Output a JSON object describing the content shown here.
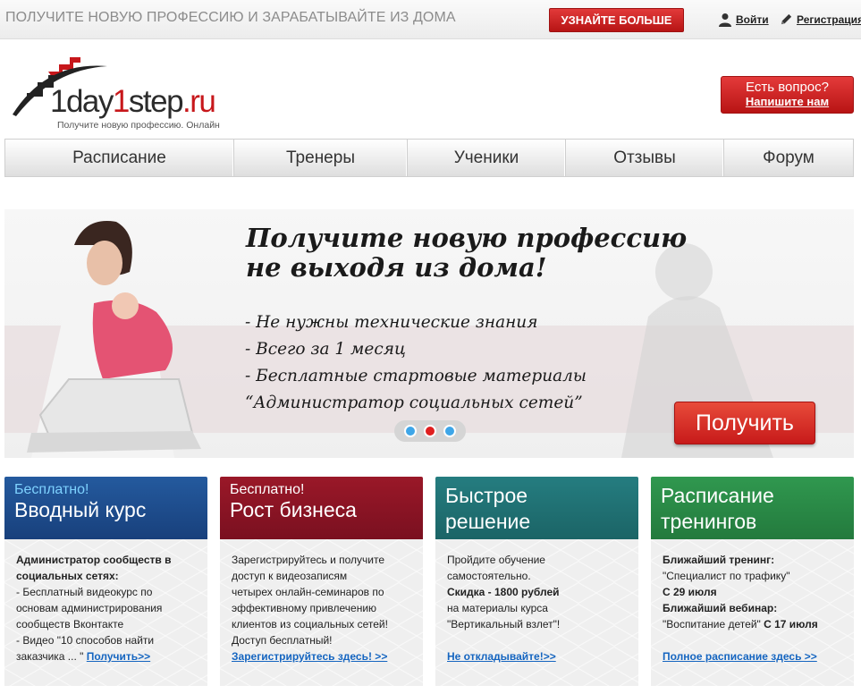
{
  "topbar": {
    "promo": "ПОЛУЧИТЕ НОВУЮ ПРОФЕССИЮ И ЗАРАБАТЫВАЙТЕ ИЗ ДОМА",
    "learn_more": "УЗНАЙТЕ БОЛЬШЕ",
    "login": "Войти",
    "register": "Регистрация"
  },
  "header": {
    "logo_prefix": "1day",
    "logo_digit": "1",
    "logo_suffix": "step",
    "logo_domain": ".ru",
    "logo_tagline": "Получите новую профессию. Онлайн",
    "question_line1": "Есть вопрос?",
    "question_line2": "Напишите нам"
  },
  "nav": {
    "items": [
      {
        "label": "Расписание"
      },
      {
        "label": "Тренеры"
      },
      {
        "label": "Ученики"
      },
      {
        "label": "Отзывы"
      },
      {
        "label": "Форум"
      }
    ]
  },
  "banner": {
    "title_line1": "Получите новую профессию",
    "title_line2": "не выходя из дома!",
    "bullets": [
      "- Не нужны технические знания",
      "- Всего за 1 месяц",
      "- Бесплатные стартовые материалы",
      "“Администратор социальных сетей”"
    ],
    "get_button": "Получить",
    "slides": 3,
    "active_slide": 2
  },
  "cards": [
    {
      "small": "Бесплатно!",
      "big": "Вводный курс",
      "bold_lines": [
        "Администратор сообществ в",
        "социальных сетях:"
      ],
      "lines": [
        "- Бесплатный видеокурс по",
        "основам администрирования",
        "сообществ Вконтакте",
        "- Видео \"10 способов найти"
      ],
      "last_text": "заказчика ... \"",
      "link": "Получить>>"
    },
    {
      "small": "Бесплатно!",
      "big": "Рост бизнеса",
      "lines": [
        "Зарегистрируйтесь и получите",
        "доступ к видеозаписям",
        "четырех онлайн-семинаров по",
        "эффективному привлечению",
        "клиентов из социальных сетей!",
        "Доступ бесплатный!"
      ],
      "link": "Зарегистрируйтесь здесь! >>"
    },
    {
      "big_line1": "Быстрое",
      "big_line2": "решение",
      "line1": "Пройдите обучение",
      "line2": "самостоятельно.",
      "bold_line": "Скидка - 1800 рублей",
      "line3": "на материалы курса",
      "line4": "\"Вертикальный взлет\"!",
      "link": "Не откладывайте!>>"
    },
    {
      "big_line1": "Расписание",
      "big_line2": "тренингов",
      "bold1": "Ближайший тренинг:",
      "text1": "\"Специалист по трафику\"",
      "bold2": "С 29 июля",
      "bold3": "Ближайший вебинар:",
      "text2": "\"Воспитание детей\" ",
      "bold4": "С 17 июля",
      "link": "Полное расписание здесь >>"
    }
  ],
  "colors": {
    "red": "#c7171b",
    "card_blue": "#1c4a8c",
    "card_maroon": "#8a1422",
    "card_teal": "#1f7072",
    "card_green": "#2a8a48",
    "link": "#1565c0"
  }
}
